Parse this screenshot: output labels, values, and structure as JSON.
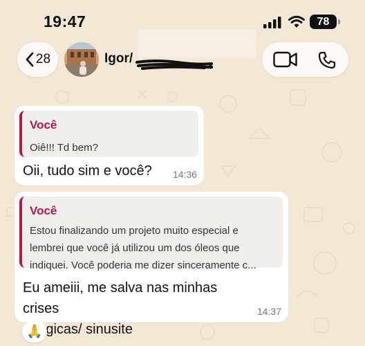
{
  "status_bar": {
    "time": "19:47",
    "battery": "78"
  },
  "header": {
    "back_count": "28",
    "contact_name": "Igor/"
  },
  "messages": [
    {
      "quote_author": "Você",
      "quote_lines": [
        "Oiê!!! Td bem?"
      ],
      "text_lines": [
        "Oii, tudo sim e você?"
      ],
      "time": "14:36"
    },
    {
      "quote_author": "Você",
      "quote_lines": [
        "Estou finalizando um projeto muito especial e",
        "lembrei que você já utilizou um dos óleos que",
        "indiquei. Você poderia me dizer sinceramente c..."
      ],
      "text_lines": [
        "Eu ameiii, me salva nas minhas crises",
        "alérgicas/ sinusite"
      ],
      "time": "14:37",
      "reaction": "🙏"
    }
  ],
  "colors": {
    "background": "#f3e7d5",
    "quote_accent": "#b8174e",
    "bubble": "#ffffff"
  },
  "icons": [
    "back-chevron-icon",
    "signal-icon",
    "wifi-icon",
    "battery-icon",
    "video-call-icon",
    "phone-call-icon"
  ]
}
